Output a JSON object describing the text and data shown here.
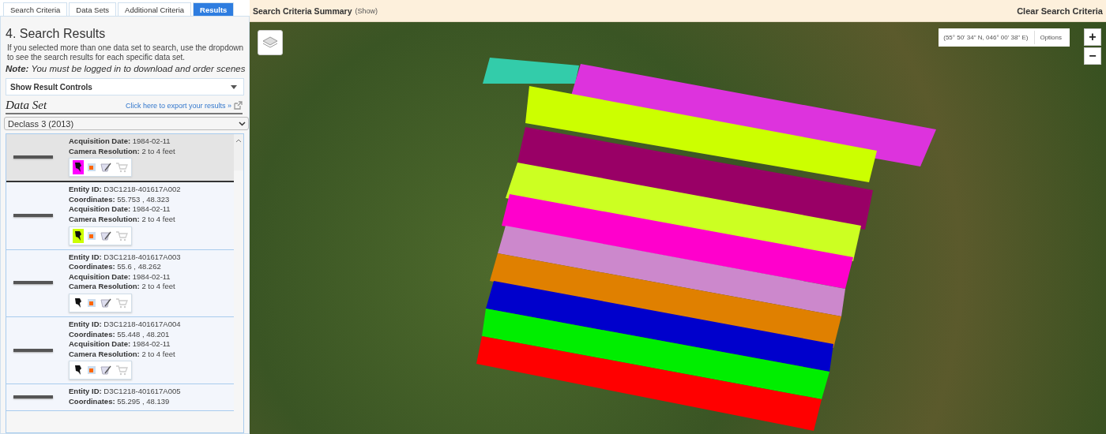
{
  "tabs": [
    {
      "label": "Search Criteria",
      "selected": false
    },
    {
      "label": "Data Sets",
      "selected": false
    },
    {
      "label": "Additional Criteria",
      "selected": false
    },
    {
      "label": "Results",
      "selected": true
    }
  ],
  "heading": "4. Search Results",
  "intro": "If you selected more than one data set to search, use the dropdown to see the search results for each specific data set.",
  "note": "**Note:** You must be logged in to download and order scenes",
  "result_controls": "Show Result Controls",
  "data_set_label": "Data Set",
  "export_link": "Click here to export your results »",
  "data_set_select": "Declass 3 (2013)",
  "results": [
    {
      "selected": true,
      "color": "#ff00ff",
      "fields": [
        {
          "label": "Acquisition Date:",
          "value": "1984-02-11"
        },
        {
          "label": "Camera Resolution:",
          "value": "2 to 4 feet"
        }
      ]
    },
    {
      "selected": false,
      "color": "#ccff00",
      "fields": [
        {
          "label": "Entity ID:",
          "value": "D3C1218-401617A002"
        },
        {
          "label": "Coordinates:",
          "value": "55.753 , 48.323"
        },
        {
          "label": "Acquisition Date:",
          "value": "1984-02-11"
        },
        {
          "label": "Camera Resolution:",
          "value": "2 to 4 feet"
        }
      ]
    },
    {
      "selected": false,
      "fields": [
        {
          "label": "Entity ID:",
          "value": "D3C1218-401617A003"
        },
        {
          "label": "Coordinates:",
          "value": "55.6 , 48.262"
        },
        {
          "label": "Acquisition Date:",
          "value": "1984-02-11"
        },
        {
          "label": "Camera Resolution:",
          "value": "2 to 4 feet"
        }
      ]
    },
    {
      "selected": false,
      "fields": [
        {
          "label": "Entity ID:",
          "value": "D3C1218-401617A004"
        },
        {
          "label": "Coordinates:",
          "value": "55.448 , 48.201"
        },
        {
          "label": "Acquisition Date:",
          "value": "1984-02-11"
        },
        {
          "label": "Camera Resolution:",
          "value": "2 to 4 feet"
        }
      ]
    },
    {
      "selected": false,
      "fields": [
        {
          "label": "Entity ID:",
          "value": "D3C1218-401617A005"
        },
        {
          "label": "Coordinates:",
          "value": "55.295 , 48.139"
        }
      ]
    }
  ],
  "summary_bar": {
    "title": "Search Criteria Summary",
    "toggle": "(Show)",
    "clear": "Clear Search Criteria"
  },
  "map": {
    "coordinates": "(55° 50' 34\" N, 046° 00' 38\" E)",
    "options": "Options",
    "zoom_in": "+",
    "zoom_out": "−",
    "footprints": [
      {
        "color": "#33ccaa"
      },
      {
        "color": "#dd33dd"
      },
      {
        "color": "#ccff00"
      },
      {
        "color": "#990066"
      },
      {
        "color": "#ccff22"
      },
      {
        "color": "#ff00cc"
      },
      {
        "color": "#cc88cc"
      },
      {
        "color": "#e08000"
      },
      {
        "color": "#0000cc"
      },
      {
        "color": "#00ee00"
      },
      {
        "color": "#ff0000"
      }
    ]
  }
}
